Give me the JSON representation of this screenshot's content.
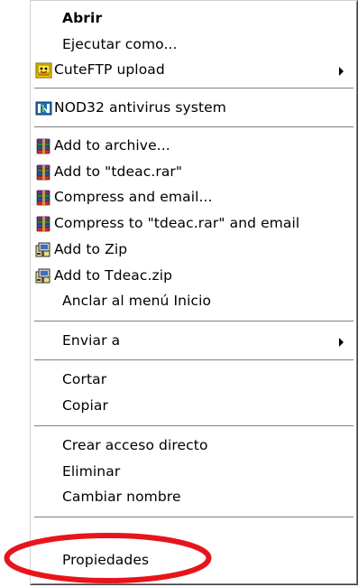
{
  "context_menu": {
    "items": [
      {
        "label": "Abrir",
        "bold": true
      },
      {
        "label": "Ejecutar como..."
      },
      {
        "label": "CuteFTP upload",
        "icon": "cuteftp-icon",
        "submenu": true
      },
      {
        "label": "NOD32 antivirus system",
        "icon": "nod32-icon"
      },
      {
        "label": "Add to archive...",
        "icon": "winrar-icon"
      },
      {
        "label": "Add to \"tdeac.rar\"",
        "icon": "winrar-icon"
      },
      {
        "label": "Compress and email...",
        "icon": "winrar-icon"
      },
      {
        "label": "Compress to \"tdeac.rar\" and email",
        "icon": "winrar-icon"
      },
      {
        "label": "Add to Zip",
        "icon": "winzip-icon"
      },
      {
        "label": "Add to Tdeac.zip",
        "icon": "winzip-icon"
      },
      {
        "label": "Anclar al menú Inicio"
      },
      {
        "label": "Enviar a",
        "submenu": true
      },
      {
        "label": "Cortar"
      },
      {
        "label": "Copiar"
      },
      {
        "label": "Crear acceso directo"
      },
      {
        "label": "Eliminar"
      },
      {
        "label": "Cambiar nombre"
      },
      {
        "label": "Propiedades",
        "highlighted": true
      }
    ]
  },
  "colors": {
    "annotation_ring": "#e8141b",
    "menu_background": "#ffffff",
    "text": "#000000"
  }
}
